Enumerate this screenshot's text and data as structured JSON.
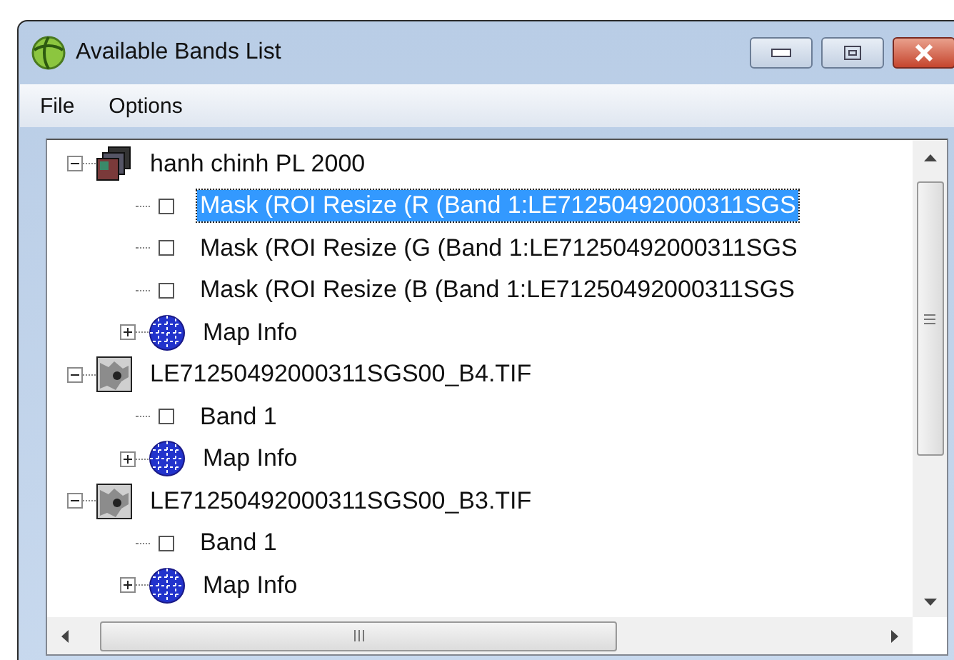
{
  "window": {
    "title": "Available Bands List"
  },
  "menu": [
    "File",
    "Options"
  ],
  "tree": [
    {
      "kind": "stack",
      "label": "hanh chinh PL 2000",
      "expanded": true,
      "selected": false,
      "children": [
        {
          "kind": "band",
          "label": "Mask (ROI Resize (R (Band 1:LE71250492000311SGS",
          "selected": true
        },
        {
          "kind": "band",
          "label": "Mask (ROI Resize (G (Band 1:LE71250492000311SGS",
          "selected": false
        },
        {
          "kind": "band",
          "label": "Mask (ROI Resize (B (Band 1:LE71250492000311SGS",
          "selected": false
        },
        {
          "kind": "map",
          "label": "Map Info",
          "expanded": false,
          "selected": false
        }
      ]
    },
    {
      "kind": "raster",
      "label": "LE71250492000311SGS00_B4.TIF",
      "expanded": true,
      "selected": false,
      "children": [
        {
          "kind": "band",
          "label": "Band 1",
          "selected": false
        },
        {
          "kind": "map",
          "label": "Map Info",
          "expanded": false,
          "selected": false
        }
      ]
    },
    {
      "kind": "raster",
      "label": "LE71250492000311SGS00_B3.TIF",
      "expanded": true,
      "selected": false,
      "children": [
        {
          "kind": "band",
          "label": "Band 1",
          "selected": false
        },
        {
          "kind": "map",
          "label": "Map Info",
          "expanded": false,
          "selected": false
        }
      ]
    }
  ]
}
